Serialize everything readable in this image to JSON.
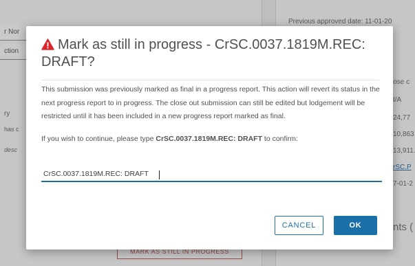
{
  "background": {
    "left_fields": [
      "r Nor",
      "ction"
    ],
    "left_misc": [
      "ry",
      "has c",
      "desc"
    ],
    "left_button": "MARK AS STILL IN PROGRESS",
    "right_header": "Previous approved date:  11-01-20",
    "right_values": [
      "lose c",
      "I/A",
      "24,77",
      "10,863",
      "13,911.",
      "rSC.P",
      "7-01-2"
    ],
    "right_heading": "nts ("
  },
  "modal": {
    "title": "Mark as still in progress - CrSC.0037.1819M.REC: DRAFT?",
    "paragraph1": "This submission was previously marked as final in a progress report. This action will revert its status in the next progress report to in progress. The close out submission can still be edited but lodgement will be restricted until it has been included in a new progress report marked as final.",
    "paragraph2_prefix": "If you wish to continue, please type ",
    "paragraph2_code": "CrSC.0037.1819M.REC: DRAFT",
    "paragraph2_suffix": " to confirm:",
    "input_value": "CrSC.0037.1819M.REC: DRAFT",
    "cancel_label": "CANCEL",
    "ok_label": "OK"
  },
  "colors": {
    "primary": "#1b6fa8",
    "warning": "#d9262b"
  }
}
